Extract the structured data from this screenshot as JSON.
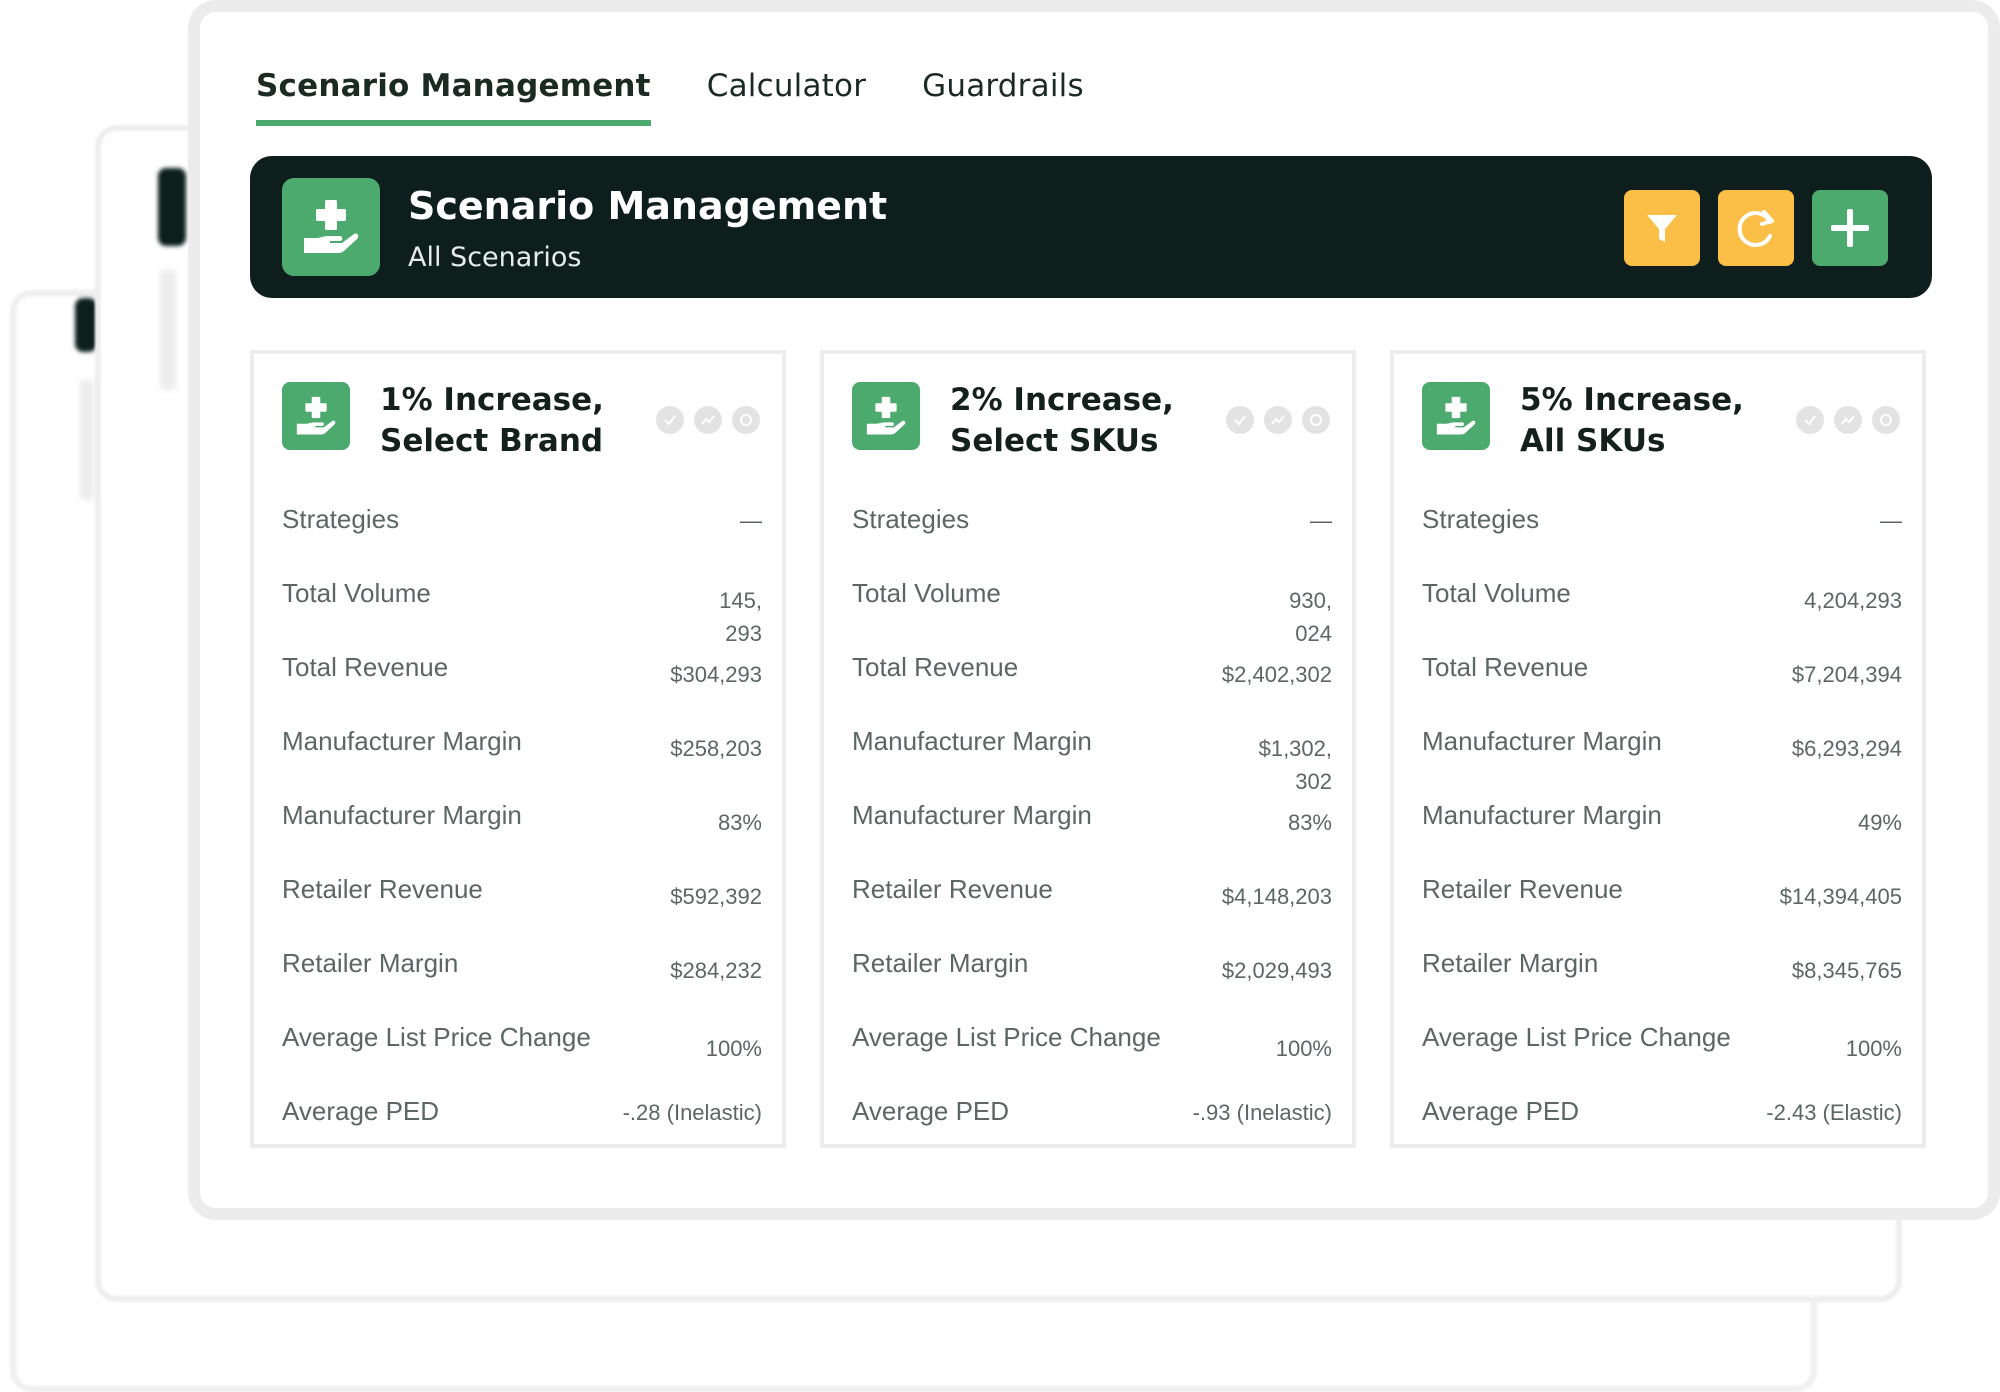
{
  "tabs": [
    {
      "label": "Scenario Management",
      "active": true
    },
    {
      "label": "Calculator",
      "active": false
    },
    {
      "label": "Guardrails",
      "active": false
    }
  ],
  "banner": {
    "title": "Scenario Management",
    "subtitle": "All Scenarios",
    "icon": "hand-plus-icon",
    "actions": [
      {
        "name": "filter",
        "icon": "filter-icon"
      },
      {
        "name": "refresh",
        "icon": "refresh-icon"
      },
      {
        "name": "add",
        "icon": "plus-icon"
      }
    ]
  },
  "colors": {
    "brand_green": "#4caa6e",
    "banner_dark": "#0e1e1d",
    "action_yellow": "#fbbf47"
  },
  "cards": [
    {
      "title": "1% Increase, Select Brand",
      "metrics": [
        {
          "label": "Strategies",
          "value": "—"
        },
        {
          "label": "Total Volume",
          "value": "145, 293"
        },
        {
          "label": "Total Revenue",
          "value": "$304,293"
        },
        {
          "label": "Manufacturer Margin",
          "value": "$258,203"
        },
        {
          "label": "Manufacturer Margin",
          "value": "83%"
        },
        {
          "label": "Retailer Revenue",
          "value": "$592,392"
        },
        {
          "label": "Retailer Margin",
          "value": "$284,232"
        },
        {
          "label": "Average List Price Change",
          "value": "100%"
        },
        {
          "label": "Average PED",
          "value": "-.28 (Inelastic)"
        }
      ]
    },
    {
      "title": "2% Increase, Select SKUs",
      "metrics": [
        {
          "label": "Strategies",
          "value": "—"
        },
        {
          "label": "Total Volume",
          "value": "930, 024"
        },
        {
          "label": "Total Revenue",
          "value": "$2,402,302"
        },
        {
          "label": "Manufacturer Margin",
          "value": "$1,302, 302"
        },
        {
          "label": "Manufacturer Margin",
          "value": "83%"
        },
        {
          "label": "Retailer Revenue",
          "value": "$4,148,203"
        },
        {
          "label": "Retailer Margin",
          "value": "$2,029,493"
        },
        {
          "label": "Average List Price Change",
          "value": "100%"
        },
        {
          "label": "Average PED",
          "value": "-.93 (Inelastic)"
        }
      ]
    },
    {
      "title": "5% Increase, All SKUs",
      "metrics": [
        {
          "label": "Strategies",
          "value": "—"
        },
        {
          "label": "Total Volume",
          "value": "4,204,293"
        },
        {
          "label": "Total Revenue",
          "value": "$7,204,394"
        },
        {
          "label": "Manufacturer Margin",
          "value": "$6,293,294"
        },
        {
          "label": "Manufacturer Margin",
          "value": "49%"
        },
        {
          "label": "Retailer Revenue",
          "value": "$14,394,405"
        },
        {
          "label": "Retailer Margin",
          "value": "$8,345,765"
        },
        {
          "label": "Average List Price Change",
          "value": "100%"
        },
        {
          "label": "Average PED",
          "value": "-2.43 (Elastic)"
        }
      ]
    }
  ]
}
